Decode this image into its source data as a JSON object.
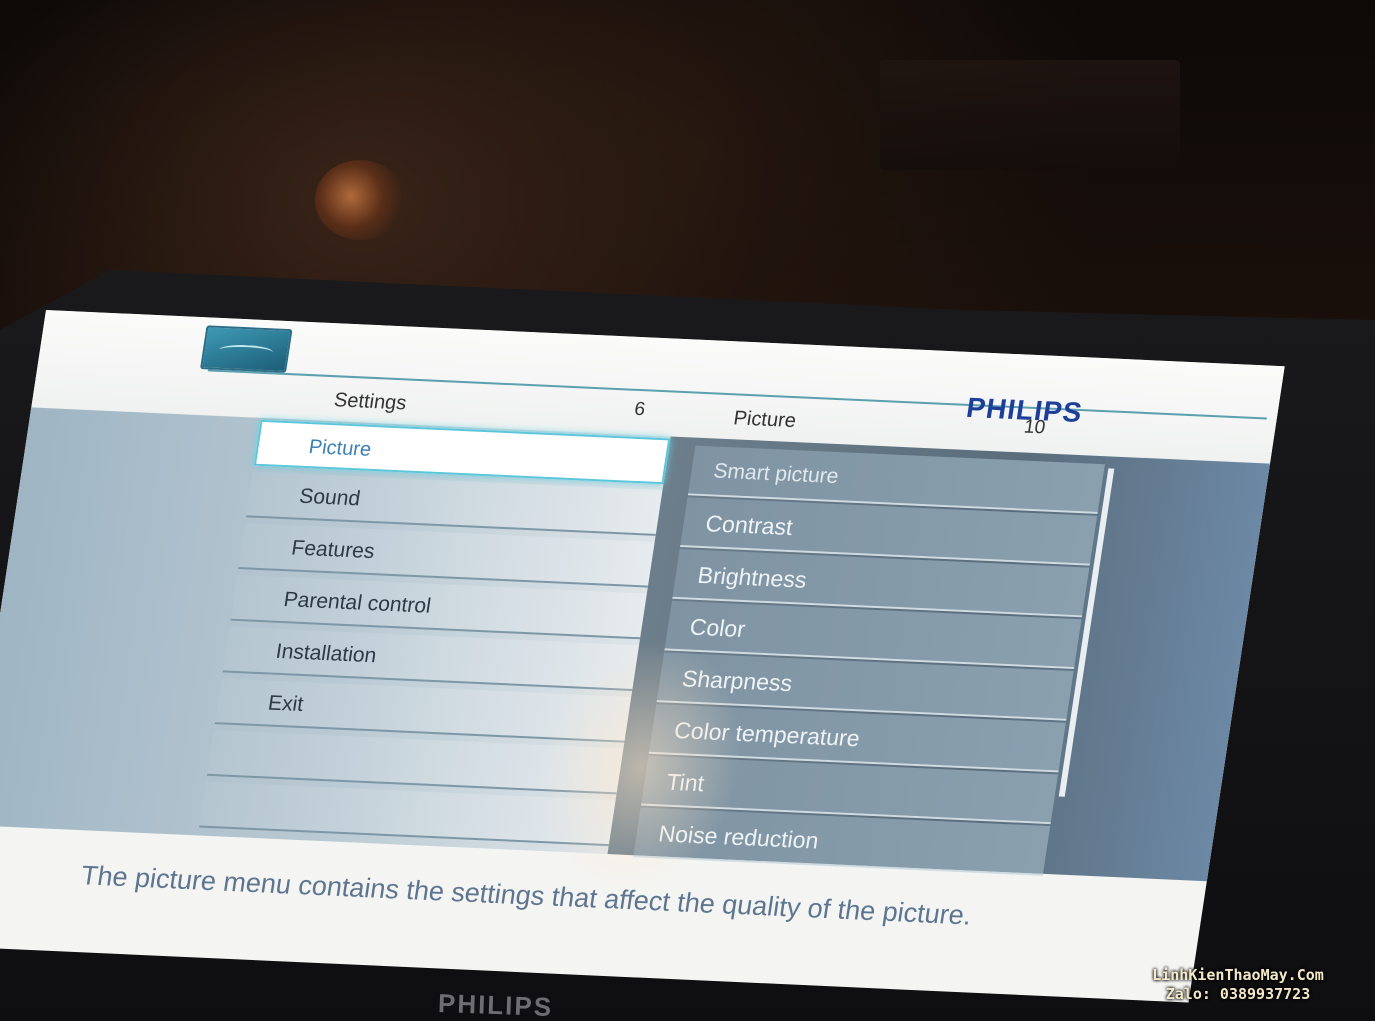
{
  "header": {
    "brand": "PHILIPS",
    "settings_title": "Settings",
    "settings_count": "6",
    "picture_title": "Picture",
    "picture_count": "10"
  },
  "settings_menu": [
    {
      "label": "Picture",
      "active": true
    },
    {
      "label": "Sound"
    },
    {
      "label": "Features"
    },
    {
      "label": "Parental control"
    },
    {
      "label": "Installation"
    },
    {
      "label": "Exit"
    },
    {
      "label": ""
    },
    {
      "label": ""
    }
  ],
  "picture_menu": [
    {
      "label": "Smart picture"
    },
    {
      "label": "Contrast"
    },
    {
      "label": "Brightness"
    },
    {
      "label": "Color"
    },
    {
      "label": "Sharpness"
    },
    {
      "label": "Color temperature"
    },
    {
      "label": "Tint"
    },
    {
      "label": "Noise reduction"
    }
  ],
  "description": "The picture menu contains the settings that affect the quality of the picture.",
  "bezel_logo": "PHILIPS",
  "watermark": {
    "line1": "LinhKienThaoMay.Com",
    "line2": "Zalo: 0389937723"
  },
  "colors": {
    "brand": "#1d3f9a",
    "highlight_border": "#5cc6da",
    "description_text": "#5d7590"
  }
}
